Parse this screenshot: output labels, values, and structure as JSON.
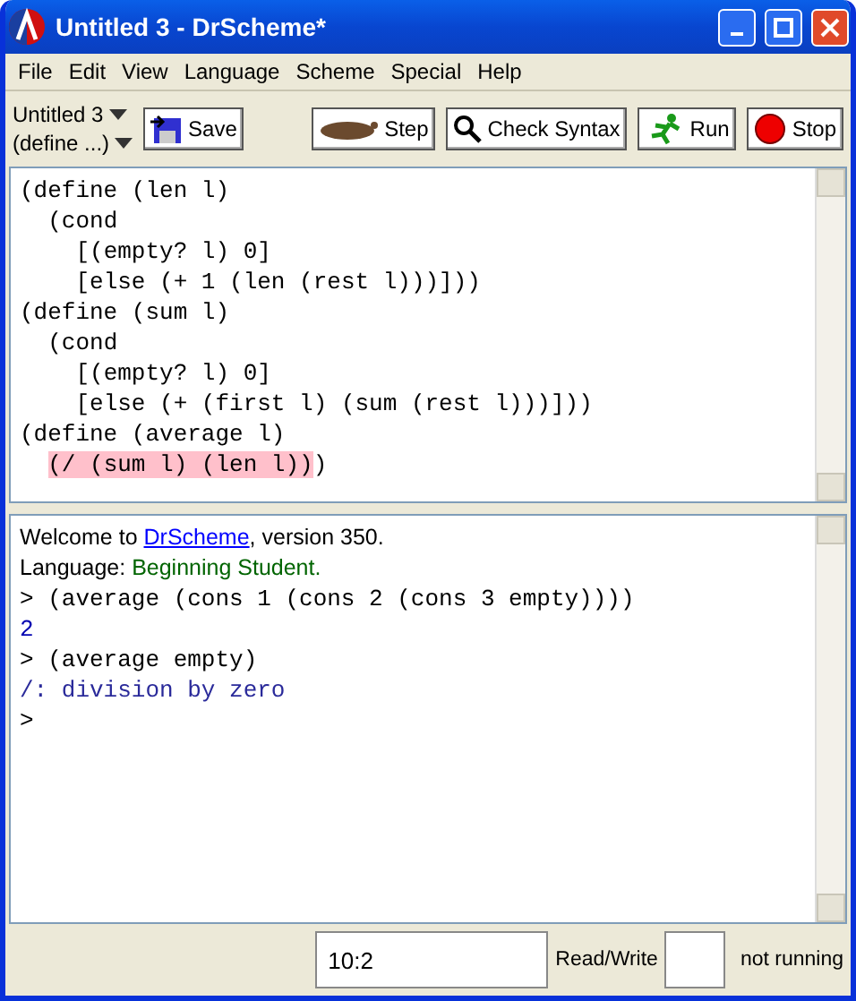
{
  "window": {
    "title": "Untitled 3 - DrScheme*"
  },
  "menu": [
    "File",
    "Edit",
    "View",
    "Language",
    "Scheme",
    "Special",
    "Help"
  ],
  "toolbar": {
    "file_name": "Untitled 3",
    "define_menu": "(define ...)",
    "save": "Save",
    "step": "Step",
    "check_syntax": "Check Syntax",
    "run": "Run",
    "stop": "Stop"
  },
  "editor": {
    "lines": [
      {
        "segments": [
          {
            "text": "(define (len l)",
            "highlighted": false
          }
        ]
      },
      {
        "segments": [
          {
            "text": "  (cond",
            "highlighted": false
          }
        ]
      },
      {
        "segments": [
          {
            "text": "    [(empty? l) 0]",
            "highlighted": false
          }
        ]
      },
      {
        "segments": [
          {
            "text": "    [else (+ 1 (len (rest l)))]))",
            "highlighted": false
          }
        ]
      },
      {
        "segments": [
          {
            "text": "(define (sum l)",
            "highlighted": false
          }
        ]
      },
      {
        "segments": [
          {
            "text": "  (cond",
            "highlighted": false
          }
        ]
      },
      {
        "segments": [
          {
            "text": "    [(empty? l) 0]",
            "highlighted": false
          }
        ]
      },
      {
        "segments": [
          {
            "text": "    [else (+ (first l) (sum (rest l)))]))",
            "highlighted": false
          }
        ]
      },
      {
        "segments": [
          {
            "text": "(define (average l)",
            "highlighted": false
          }
        ]
      },
      {
        "segments": [
          {
            "text": "  (/ (sum l) (len l))",
            "highlighted": true
          },
          {
            "text": ")",
            "highlighted": false
          }
        ]
      }
    ]
  },
  "interactions": {
    "lines": [
      {
        "kind": "welcome",
        "before": "Welcome to ",
        "link": "DrScheme",
        "after": ", version 350."
      },
      {
        "kind": "language",
        "label": "Language: ",
        "value": "Beginning Student."
      },
      {
        "kind": "input",
        "text": "> (average (cons 1 (cons 2 (cons 3 empty))))"
      },
      {
        "kind": "output",
        "text": "2"
      },
      {
        "kind": "input",
        "text": "> (average empty)"
      },
      {
        "kind": "error",
        "text": "/: division by zero"
      },
      {
        "kind": "input",
        "text": ">"
      }
    ]
  },
  "status_bar": {
    "position": "10:2",
    "mode": "Read/Write",
    "state": "not running"
  }
}
